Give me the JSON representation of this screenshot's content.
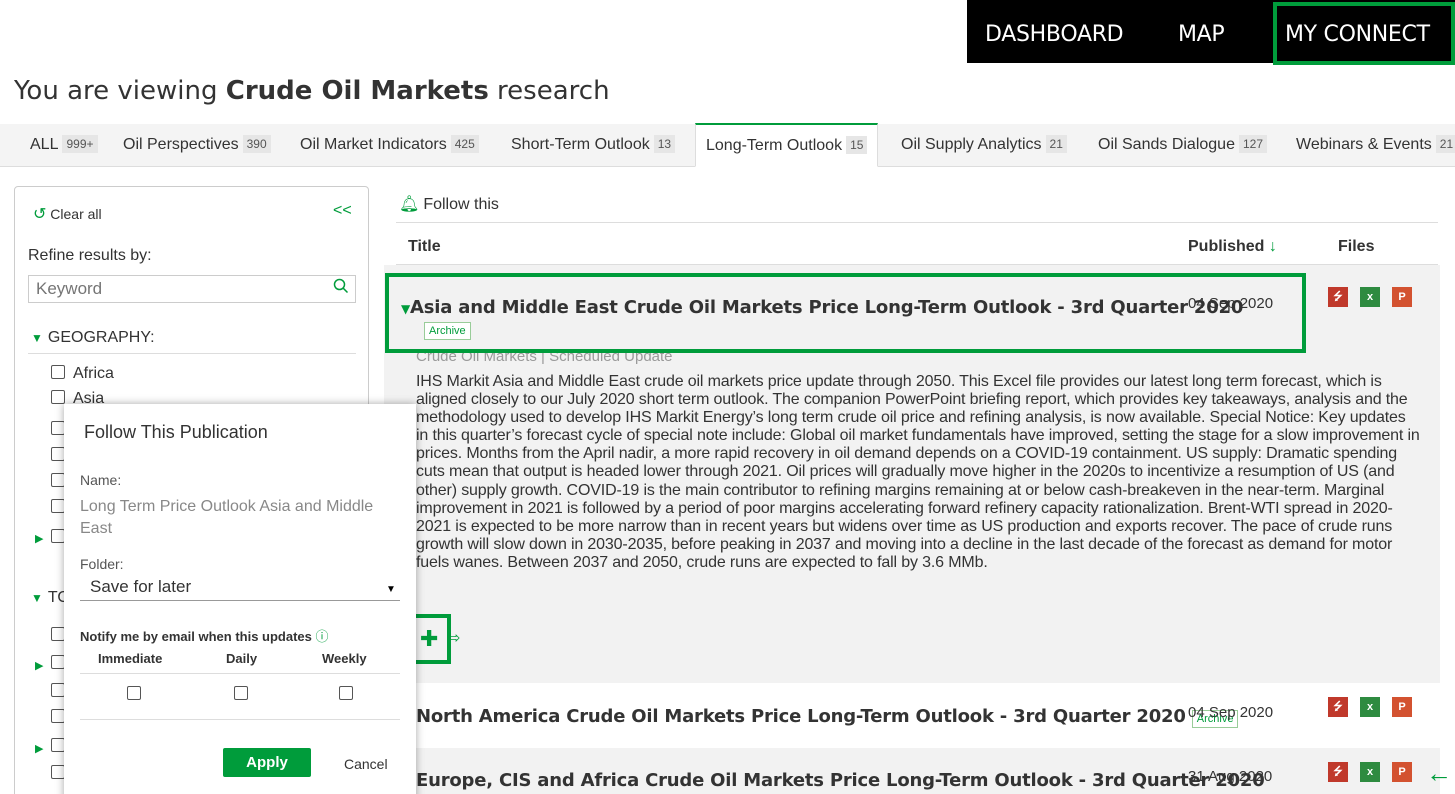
{
  "nav": {
    "dashboard": "DASHBOARD",
    "map": "MAP",
    "my_connect": "MY CONNECT"
  },
  "heading": {
    "prefix": "You are viewing ",
    "subject": "Crude Oil Markets",
    "suffix": " research"
  },
  "tabs": [
    {
      "label": "ALL",
      "count": "999+"
    },
    {
      "label": "Oil Perspectives",
      "count": "390"
    },
    {
      "label": "Oil Market Indicators",
      "count": "425"
    },
    {
      "label": "Short-Term Outlook",
      "count": "13"
    },
    {
      "label": "Long-Term Outlook",
      "count": "15",
      "active": true
    },
    {
      "label": "Oil Supply Analytics",
      "count": "21"
    },
    {
      "label": "Oil Sands Dialogue",
      "count": "127"
    },
    {
      "label": "Webinars & Events",
      "count": "21"
    }
  ],
  "sidebar": {
    "clear_all": "Clear all",
    "collapse": "<<",
    "refine_label": "Refine results by:",
    "keyword_placeholder": "Keyword",
    "geography_label": "GEOGRAPHY:",
    "geography_items": [
      "Africa",
      "Asia"
    ],
    "topic_label_partial": "TO"
  },
  "follow_popup": {
    "title": "Follow This Publication",
    "name_label": "Name:",
    "name_value": "Long Term Price Outlook Asia and Middle East",
    "folder_label": "Folder:",
    "folder_value": "Save for later",
    "notify_label": "Notify me by email when this updates",
    "frequencies": [
      "Immediate",
      "Daily",
      "Weekly"
    ],
    "apply": "Apply",
    "cancel": "Cancel"
  },
  "main": {
    "follow_this": "Follow this",
    "col_title": "Title",
    "col_published": "Published",
    "col_files": "Files",
    "rows": [
      {
        "title": "Asia and Middle East Crude Oil Markets Price Long-Term Outlook - 3rd Quarter 2020",
        "badge": "Archive",
        "date": "04 Sep 2020",
        "meta": "Crude Oil Markets | Scheduled Update",
        "description": "IHS Markit Asia and Middle East crude oil markets price update through 2050. This Excel file provides our latest long term forecast, which is aligned closely to our July 2020 short term outlook. The companion PowerPoint briefing report, which provides key takeaways, analysis and the methodology used to develop IHS Markit Energy’s long term crude oil price and refining analysis, is now available. Special Notice: Key updates in this quarter’s forecast cycle of special note include: Global oil market fundamentals have improved, setting the stage for a slow improvement in prices. Months from the April nadir, a more rapid recovery in oil demand depends on a COVID-19 containment. US supply: Dramatic spending cuts mean that output is headed lower through 2021. Oil prices will gradually move higher in the 2020s to incentivize a resumption of US (and other) supply growth. COVID-19 is the main contributor to refining margins remaining at or below cash-breakeven in the near-term. Marginal improvement in 2021 is followed by a period of poor margins accelerating forward refinery capacity rationalization. Brent-WTI spread in 2020-2021 is expected to be more narrow than in recent years but widens over time as US production and exports recover. The pace of crude runs growth will slow down in 2030-2035, before peaking in 2037 and moving into a decline in the last decade of the forecast as demand for motor fuels wanes. Between 2037 and 2050, crude runs are expected to fall by 3.6 MMb."
      },
      {
        "title": "North America Crude Oil Markets Price Long-Term Outlook - 3rd Quarter 2020",
        "badge": "Archive",
        "date": "04 Sep 2020"
      },
      {
        "title": "Europe, CIS and Africa Crude Oil Markets Price Long-Term Outlook - 3rd Quarter 2020",
        "date": "31 Aug 2020"
      }
    ],
    "file_icons": {
      "pdf": "pdf-icon",
      "xls": "excel-icon",
      "ppt": "powerpoint-icon"
    }
  },
  "colors": {
    "accent": "#009c3b",
    "nav_bg": "#000000",
    "pdf": "#c0392b",
    "xls": "#2e8b40",
    "ppt": "#d35230"
  }
}
